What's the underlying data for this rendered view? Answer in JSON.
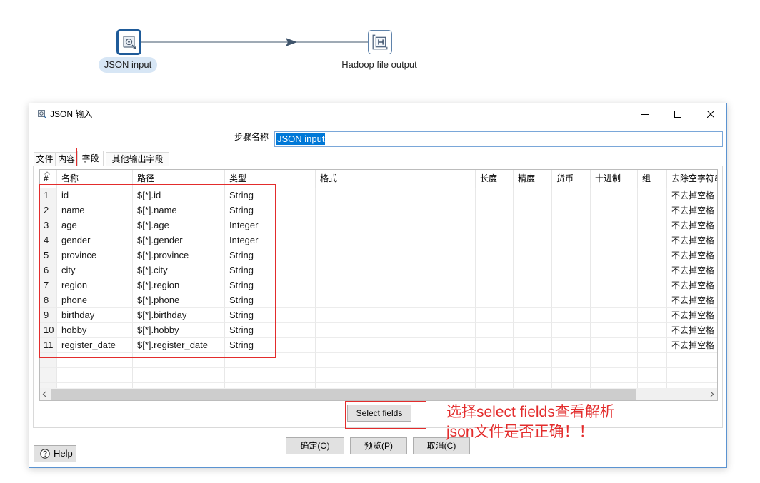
{
  "canvas": {
    "steps": [
      {
        "label": "JSON input",
        "icon": "json-input-step-icon",
        "selected": true
      },
      {
        "label": "Hadoop file output",
        "icon": "hadoop-file-output-step-icon"
      }
    ],
    "hop_icon": "hop-arrow-icon"
  },
  "dialog": {
    "title": "JSON 输入",
    "title_icon": "json-input-dialog-icon",
    "window_controls": [
      "minimize-icon",
      "maximize-icon",
      "close-icon"
    ],
    "step_name": {
      "label": "步骤名称",
      "value": "JSON input"
    },
    "tabs": [
      {
        "label": "文件"
      },
      {
        "label": "内容"
      },
      {
        "label": "字段",
        "selected": true
      },
      {
        "label": "其他输出字段"
      }
    ],
    "fields_table": {
      "sort_icon": "sort-ascending-icon",
      "columns": {
        "num": "#",
        "name": "名称",
        "path": "路径",
        "type": "类型",
        "format": "格式",
        "length": "长度",
        "precision": "精度",
        "currency": "货币",
        "decimal": "十进制",
        "group": "组",
        "trim": "去除空字符串"
      },
      "rows": [
        {
          "num": 1,
          "name": "id",
          "path": "$[*].id",
          "type": "String",
          "trim": "不去掉空格"
        },
        {
          "num": 2,
          "name": "name",
          "path": "$[*].name",
          "type": "String",
          "trim": "不去掉空格"
        },
        {
          "num": 3,
          "name": "age",
          "path": "$[*].age",
          "type": "Integer",
          "trim": "不去掉空格"
        },
        {
          "num": 4,
          "name": "gender",
          "path": "$[*].gender",
          "type": "Integer",
          "trim": "不去掉空格"
        },
        {
          "num": 5,
          "name": "province",
          "path": "$[*].province",
          "type": "String",
          "trim": "不去掉空格"
        },
        {
          "num": 6,
          "name": "city",
          "path": "$[*].city",
          "type": "String",
          "trim": "不去掉空格"
        },
        {
          "num": 7,
          "name": "region",
          "path": "$[*].region",
          "type": "String",
          "trim": "不去掉空格"
        },
        {
          "num": 8,
          "name": "phone",
          "path": "$[*].phone",
          "type": "String",
          "trim": "不去掉空格"
        },
        {
          "num": 9,
          "name": "birthday",
          "path": "$[*].birthday",
          "type": "String",
          "trim": "不去掉空格"
        },
        {
          "num": 10,
          "name": "hobby",
          "path": "$[*].hobby",
          "type": "String",
          "trim": "不去掉空格"
        },
        {
          "num": 11,
          "name": "register_date",
          "path": "$[*].register_date",
          "type": "String",
          "trim": "不去掉空格"
        }
      ]
    },
    "select_fields_button": "Select fields",
    "help_icon": "help-icon",
    "buttons": {
      "help": "Help",
      "ok": "确定(O)",
      "preview": "预览(P)",
      "cancel": "取消(C)"
    }
  },
  "annotation": {
    "lines": [
      "选择select fields查看解析",
      "json文件是否正确！！"
    ],
    "color": "#e32c2c"
  },
  "colors": {
    "selection": "#0078d7"
  }
}
